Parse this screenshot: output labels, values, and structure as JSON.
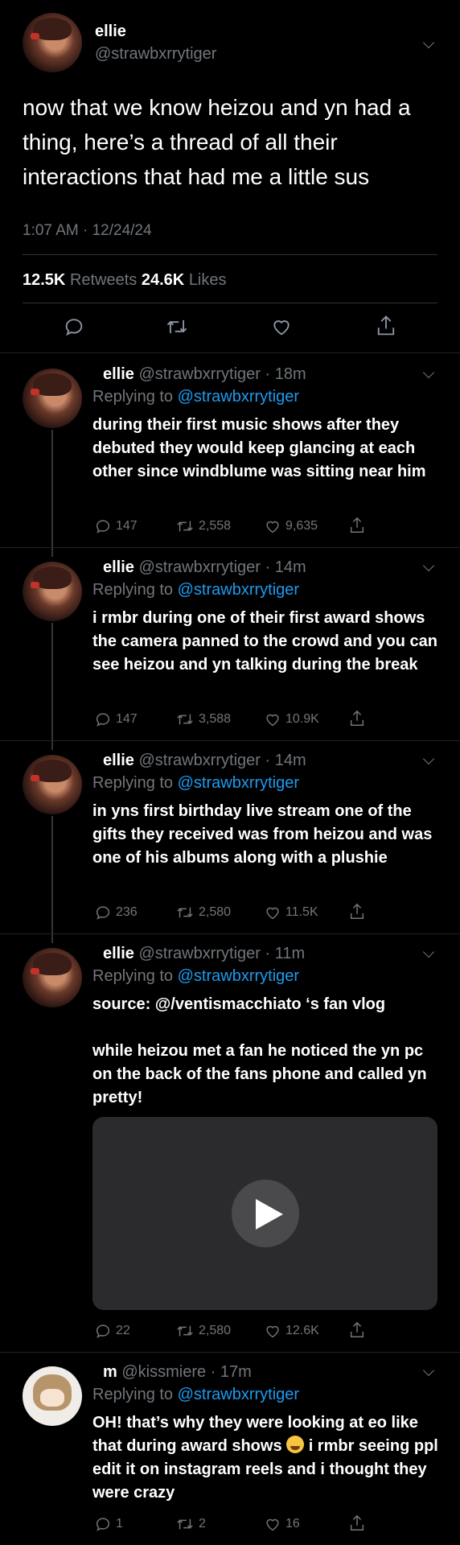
{
  "main_tweet": {
    "display_name": "ellie",
    "handle": "@strawbxrrytiger",
    "text": "now that we know heizou and yn had a thing, here’s a thread of all their interactions that had me a little sus",
    "time": "1:07 AM · 12/24/24",
    "retweets_count": "12.5K",
    "retweets_label": "Retweets",
    "likes_count": "24.6K",
    "likes_label": "Likes"
  },
  "replies": [
    {
      "display_name": "ellie",
      "meta": "@strawbxrrytiger · 18m",
      "replying_prefix": "Replying to",
      "replying_to": "@strawbxrrytiger",
      "paragraphs": [
        "during their first music shows after they debuted they would keep glancing at each other since windblume was sitting near him"
      ],
      "replies": "147",
      "retweets": "2,558",
      "likes": "9,635"
    },
    {
      "display_name": "ellie",
      "meta": "@strawbxrrytiger · 14m",
      "replying_prefix": "Replying to",
      "replying_to": "@strawbxrrytiger",
      "paragraphs": [
        "i rmbr during one of their first award shows the camera panned to the crowd and you can see heizou and yn talking during the break"
      ],
      "replies": "147",
      "retweets": "3,588",
      "likes": "10.9K"
    },
    {
      "display_name": "ellie",
      "meta": "@strawbxrrytiger · 14m",
      "replying_prefix": "Replying to",
      "replying_to": "@strawbxrrytiger",
      "paragraphs": [
        "in yns first birthday live stream one of the gifts they received was from heizou and was one of his albums along with a plushie"
      ],
      "replies": "236",
      "retweets": "2,580",
      "likes": "11.5K"
    },
    {
      "display_name": "ellie",
      "meta": "@strawbxrrytiger · 11m",
      "replying_prefix": "Replying to",
      "replying_to": "@strawbxrrytiger",
      "paragraphs": [
        "source: @/ventismacchiato ‘s fan vlog",
        "while heizou met a fan he noticed the yn pc on the back of the fans phone and called yn pretty!"
      ],
      "replies": "22",
      "retweets": "2,580",
      "likes": "12.6K"
    },
    {
      "display_name": "m",
      "meta": "@kissmiere · 17m",
      "replying_prefix": "Replying to",
      "replying_to": "@strawbxrrytiger",
      "text_before_emoji": "OH! that’s why they were looking at eo like that during award shows ",
      "emoji_name": "loudly-crying-face",
      "text_after_emoji": " i rmbr seeing ppl edit it on instagram reels and i thought they were crazy",
      "replies": "1",
      "retweets": "2",
      "likes": "16"
    }
  ],
  "icons": [
    "chevron-down-icon",
    "reply-icon",
    "retweet-icon",
    "like-icon",
    "share-icon",
    "play-icon"
  ],
  "colors": {
    "background": "#000000",
    "text": "#e7e9ea",
    "muted": "#71767b",
    "link": "#1d9bf0"
  }
}
